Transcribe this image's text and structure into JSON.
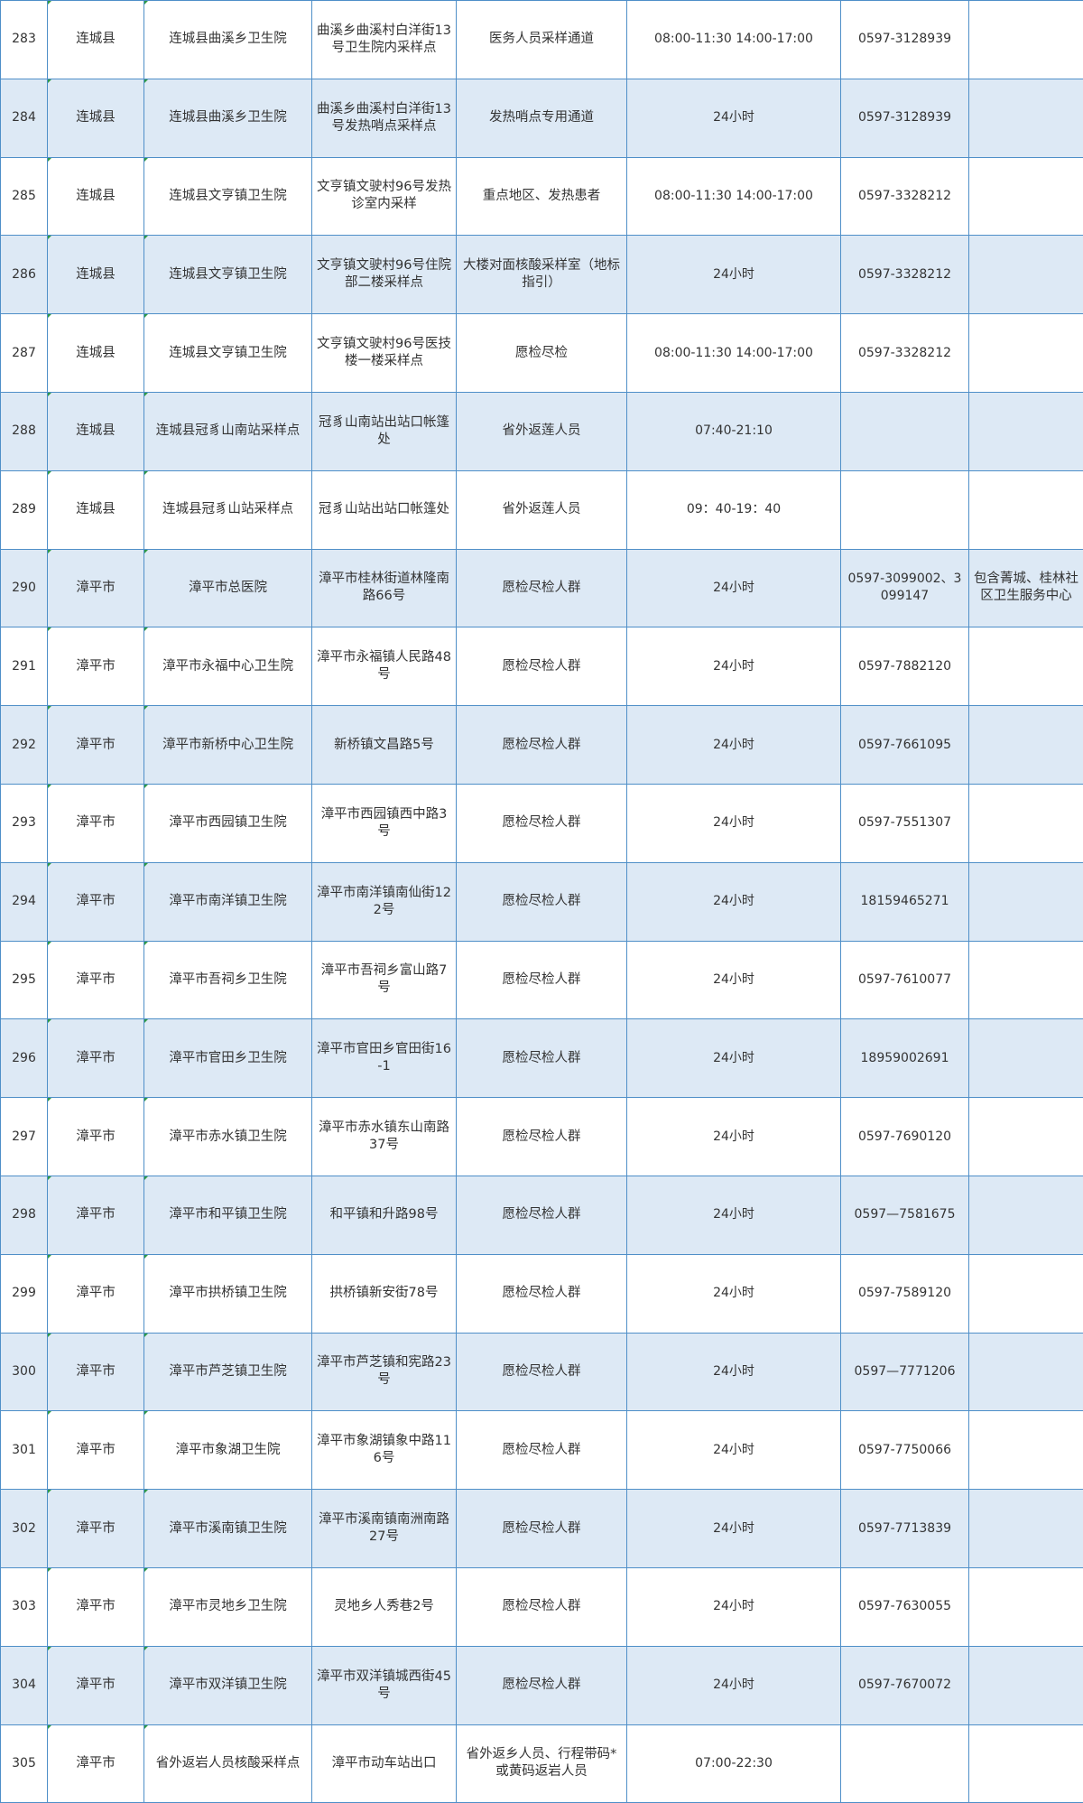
{
  "rows": [
    {
      "no": "283",
      "county": "连城县",
      "institution": "连城县曲溪乡卫生院",
      "address": "曲溪乡曲溪村白洋街13号卫生院内采样点",
      "target": "医务人员采样通道",
      "hours": "08:00-11:30 14:00-17:00",
      "phone": "0597-3128939",
      "note": ""
    },
    {
      "no": "284",
      "county": "连城县",
      "institution": "连城县曲溪乡卫生院",
      "address": "曲溪乡曲溪村白洋街13号发热哨点采样点",
      "target": "发热哨点专用通道",
      "hours": "24小时",
      "phone": "0597-3128939",
      "note": ""
    },
    {
      "no": "285",
      "county": "连城县",
      "institution": "连城县文亨镇卫生院",
      "address": "文亨镇文驶村96号发热诊室内采样",
      "target": "重点地区、发热患者",
      "hours": "08:00-11:30 14:00-17:00",
      "phone": "0597-3328212",
      "note": ""
    },
    {
      "no": "286",
      "county": "连城县",
      "institution": "连城县文亨镇卫生院",
      "address": "文亨镇文驶村96号住院部二楼采样点",
      "target": "大楼对面核酸采样室（地标指引）",
      "hours": "24小时",
      "phone": "0597-3328212",
      "note": ""
    },
    {
      "no": "287",
      "county": "连城县",
      "institution": "连城县文亨镇卫生院",
      "address": "文亨镇文驶村96号医技楼一楼采样点",
      "target": "愿检尽检",
      "hours": "08:00-11:30 14:00-17:00",
      "phone": "0597-3328212",
      "note": ""
    },
    {
      "no": "288",
      "county": "连城县",
      "institution": "连城县冠豸山南站采样点",
      "address": "冠豸山南站出站口帐篷处",
      "target": "省外返莲人员",
      "hours": "07:40-21:10",
      "phone": "",
      "note": ""
    },
    {
      "no": "289",
      "county": "连城县",
      "institution": "连城县冠豸山站采样点",
      "address": "冠豸山站出站口帐篷处",
      "target": "省外返莲人员",
      "hours": "09：40-19：40",
      "phone": "",
      "note": ""
    },
    {
      "no": "290",
      "county": "漳平市",
      "institution": "漳平市总医院",
      "address": "漳平市桂林街道林隆南路66号",
      "target": "愿检尽检人群",
      "hours": "24小时",
      "phone": "0597-3099002、3099147",
      "note": "包含菁城、桂林社区卫生服务中心"
    },
    {
      "no": "291",
      "county": "漳平市",
      "institution": "漳平市永福中心卫生院",
      "address": "漳平市永福镇人民路48号",
      "target": "愿检尽检人群",
      "hours": "24小时",
      "phone": "0597-7882120",
      "note": ""
    },
    {
      "no": "292",
      "county": "漳平市",
      "institution": "漳平市新桥中心卫生院",
      "address": "新桥镇文昌路5号",
      "target": "愿检尽检人群",
      "hours": "24小时",
      "phone": "0597-7661095",
      "note": ""
    },
    {
      "no": "293",
      "county": "漳平市",
      "institution": "漳平市西园镇卫生院",
      "address": "漳平市西园镇西中路3号",
      "target": "愿检尽检人群",
      "hours": "24小时",
      "phone": "0597-7551307",
      "note": ""
    },
    {
      "no": "294",
      "county": "漳平市",
      "institution": "漳平市南洋镇卫生院",
      "address": "漳平市南洋镇南仙街122号",
      "target": "愿检尽检人群",
      "hours": "24小时",
      "phone": "18159465271",
      "note": ""
    },
    {
      "no": "295",
      "county": "漳平市",
      "institution": "漳平市吾祠乡卫生院",
      "address": "漳平市吾祠乡富山路7号",
      "target": "愿检尽检人群",
      "hours": "24小时",
      "phone": "0597-7610077",
      "note": ""
    },
    {
      "no": "296",
      "county": "漳平市",
      "institution": "漳平市官田乡卫生院",
      "address": "漳平市官田乡官田街16-1",
      "target": "愿检尽检人群",
      "hours": "24小时",
      "phone": "18959002691",
      "note": ""
    },
    {
      "no": "297",
      "county": "漳平市",
      "institution": "漳平市赤水镇卫生院",
      "address": "漳平市赤水镇东山南路37号",
      "target": "愿检尽检人群",
      "hours": "24小时",
      "phone": "0597-7690120",
      "note": ""
    },
    {
      "no": "298",
      "county": "漳平市",
      "institution": "漳平市和平镇卫生院",
      "address": "和平镇和升路98号",
      "target": "愿检尽检人群",
      "hours": "24小时",
      "phone": "0597—7581675",
      "note": ""
    },
    {
      "no": "299",
      "county": "漳平市",
      "institution": "漳平市拱桥镇卫生院",
      "address": "拱桥镇新安街78号",
      "target": "愿检尽检人群",
      "hours": "24小时",
      "phone": "0597-7589120",
      "note": ""
    },
    {
      "no": "300",
      "county": "漳平市",
      "institution": "漳平市芦芝镇卫生院",
      "address": "漳平市芦芝镇和宪路23号",
      "target": "愿检尽检人群",
      "hours": "24小时",
      "phone": "0597—7771206",
      "note": ""
    },
    {
      "no": "301",
      "county": "漳平市",
      "institution": "漳平市象湖卫生院",
      "address": "漳平市象湖镇象中路116号",
      "target": "愿检尽检人群",
      "hours": "24小时",
      "phone": "0597-7750066",
      "note": ""
    },
    {
      "no": "302",
      "county": "漳平市",
      "institution": "漳平市溪南镇卫生院",
      "address": "漳平市溪南镇南洲南路27号",
      "target": "愿检尽检人群",
      "hours": "24小时",
      "phone": "0597-7713839",
      "note": ""
    },
    {
      "no": "303",
      "county": "漳平市",
      "institution": "漳平市灵地乡卫生院",
      "address": "灵地乡人秀巷2号",
      "target": "愿检尽检人群",
      "hours": "24小时",
      "phone": "0597-7630055",
      "note": ""
    },
    {
      "no": "304",
      "county": "漳平市",
      "institution": "漳平市双洋镇卫生院",
      "address": "漳平市双洋镇城西街45号",
      "target": "愿检尽检人群",
      "hours": "24小时",
      "phone": "0597-7670072",
      "note": ""
    },
    {
      "no": "305",
      "county": "漳平市",
      "institution": "省外返岩人员核酸采样点",
      "address": "漳平市动车站出口",
      "target": "省外返乡人员、行程带码*或黄码返岩人员",
      "hours": "07:00-22:30",
      "phone": "",
      "note": ""
    }
  ]
}
